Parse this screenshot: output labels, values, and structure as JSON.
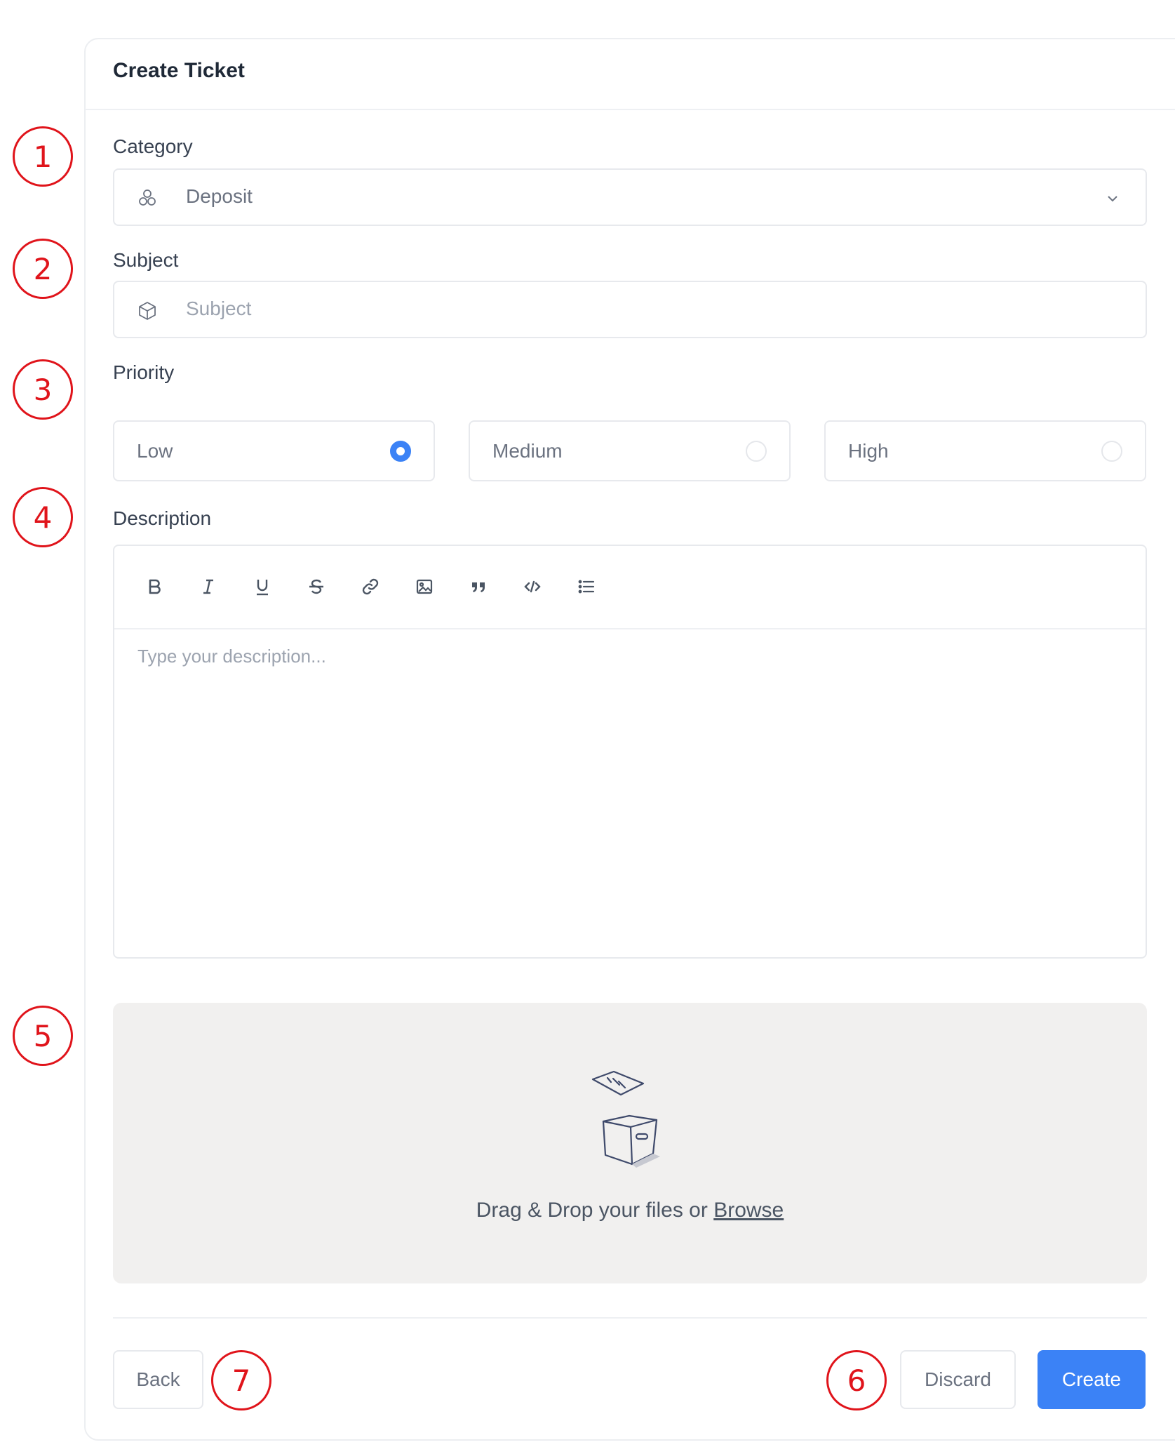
{
  "header": {
    "title": "Create Ticket"
  },
  "category": {
    "label": "Category",
    "value": "Deposit",
    "icon": "cubes-icon"
  },
  "subject": {
    "label": "Subject",
    "placeholder": "Subject",
    "icon": "box-icon"
  },
  "priority": {
    "label": "Priority",
    "options": [
      {
        "label": "Low",
        "selected": true
      },
      {
        "label": "Medium",
        "selected": false
      },
      {
        "label": "High",
        "selected": false
      }
    ]
  },
  "description": {
    "label": "Description",
    "placeholder": "Type your description...",
    "toolbar": [
      "bold",
      "italic",
      "underline",
      "strikethrough",
      "link",
      "image",
      "quote",
      "code",
      "bulleted-list"
    ]
  },
  "upload": {
    "text": "Drag & Drop your files or",
    "browse": "Browse"
  },
  "footer": {
    "back": "Back",
    "discard": "Discard",
    "create": "Create"
  },
  "markers": [
    "1",
    "2",
    "3",
    "4",
    "5",
    "6",
    "7"
  ],
  "colors": {
    "accent": "#3b82f6",
    "marker": "#e0141b",
    "dropzone": "#f1f0ef"
  }
}
